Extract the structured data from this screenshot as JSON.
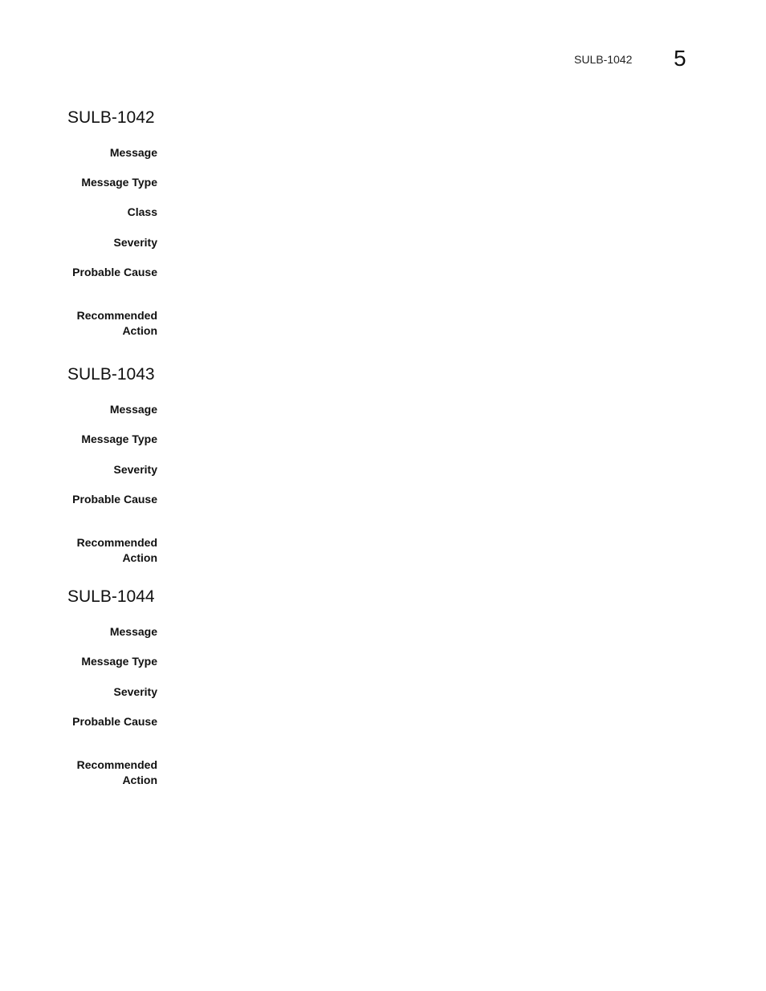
{
  "header": {
    "running_title": "SULB-1042",
    "chapter_number": "5"
  },
  "sections": [
    {
      "title": "SULB-1042",
      "fields": [
        {
          "label": "Message",
          "value": ""
        },
        {
          "label": "Message Type",
          "value": ""
        },
        {
          "label": "Class",
          "value": ""
        },
        {
          "label": "Severity",
          "value": ""
        },
        {
          "label": "Probable Cause",
          "value": ""
        },
        {
          "label_line1": "Recommended",
          "label_line2": "Action",
          "value": ""
        }
      ]
    },
    {
      "title": "SULB-1043",
      "fields": [
        {
          "label": "Message",
          "value": ""
        },
        {
          "label": "Message Type",
          "value": ""
        },
        {
          "label": "Severity",
          "value": ""
        },
        {
          "label": "Probable Cause",
          "value": ""
        },
        {
          "label_line1": "Recommended",
          "label_line2": "Action",
          "value": ""
        }
      ]
    },
    {
      "title": "SULB-1044",
      "fields": [
        {
          "label": "Message",
          "value": ""
        },
        {
          "label": "Message Type",
          "value": ""
        },
        {
          "label": "Severity",
          "value": ""
        },
        {
          "label": "Probable Cause",
          "value": ""
        },
        {
          "label_line1": "Recommended",
          "label_line2": "Action",
          "value": ""
        }
      ]
    }
  ]
}
